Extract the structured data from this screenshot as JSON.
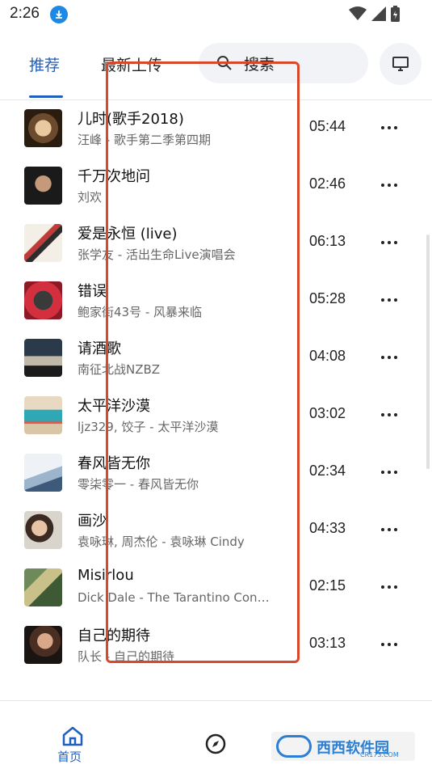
{
  "status_bar": {
    "time": "2:26"
  },
  "header": {
    "tabs": [
      {
        "label": "推荐",
        "active": true
      },
      {
        "label": "最新上传",
        "active": false
      }
    ],
    "search_label": "搜索",
    "accent_color": "#1e5fbf",
    "highlight_color": "#d9482b"
  },
  "songs": [
    {
      "title": "儿时(歌手2018)",
      "subtitle": "汪峰 - 歌手第二季第四期",
      "duration": "05:44"
    },
    {
      "title": "千万次地问",
      "subtitle": "刘欢",
      "duration": "02:46"
    },
    {
      "title": "爱是永恒 (live)",
      "subtitle": "张学友 - 活出生命Live演唱会",
      "duration": "06:13"
    },
    {
      "title": "错误",
      "subtitle": "鲍家街43号 - 风暴来临",
      "duration": "05:28"
    },
    {
      "title": "请酒歌",
      "subtitle": "南征北战NZBZ",
      "duration": "04:08"
    },
    {
      "title": "太平洋沙漠",
      "subtitle": "ljz329, 饺子 - 太平洋沙漠",
      "duration": "03:02"
    },
    {
      "title": "春风皆无你",
      "subtitle": "零柒零一 - 春风皆无你",
      "duration": "02:34"
    },
    {
      "title": "画沙",
      "subtitle": "袁咏琳, 周杰伦 - 袁咏琳 Cindy",
      "duration": "04:33"
    },
    {
      "title": "Misirlou",
      "subtitle": "Dick Dale - The Tarantino Con…",
      "duration": "02:15"
    },
    {
      "title": "自己的期待",
      "subtitle": "队长 - 自己的期待",
      "duration": "03:13"
    }
  ],
  "bottom_nav": {
    "home_label": "首页",
    "watermark_text": "西西软件园",
    "watermark_sub": "CR173.COM"
  }
}
